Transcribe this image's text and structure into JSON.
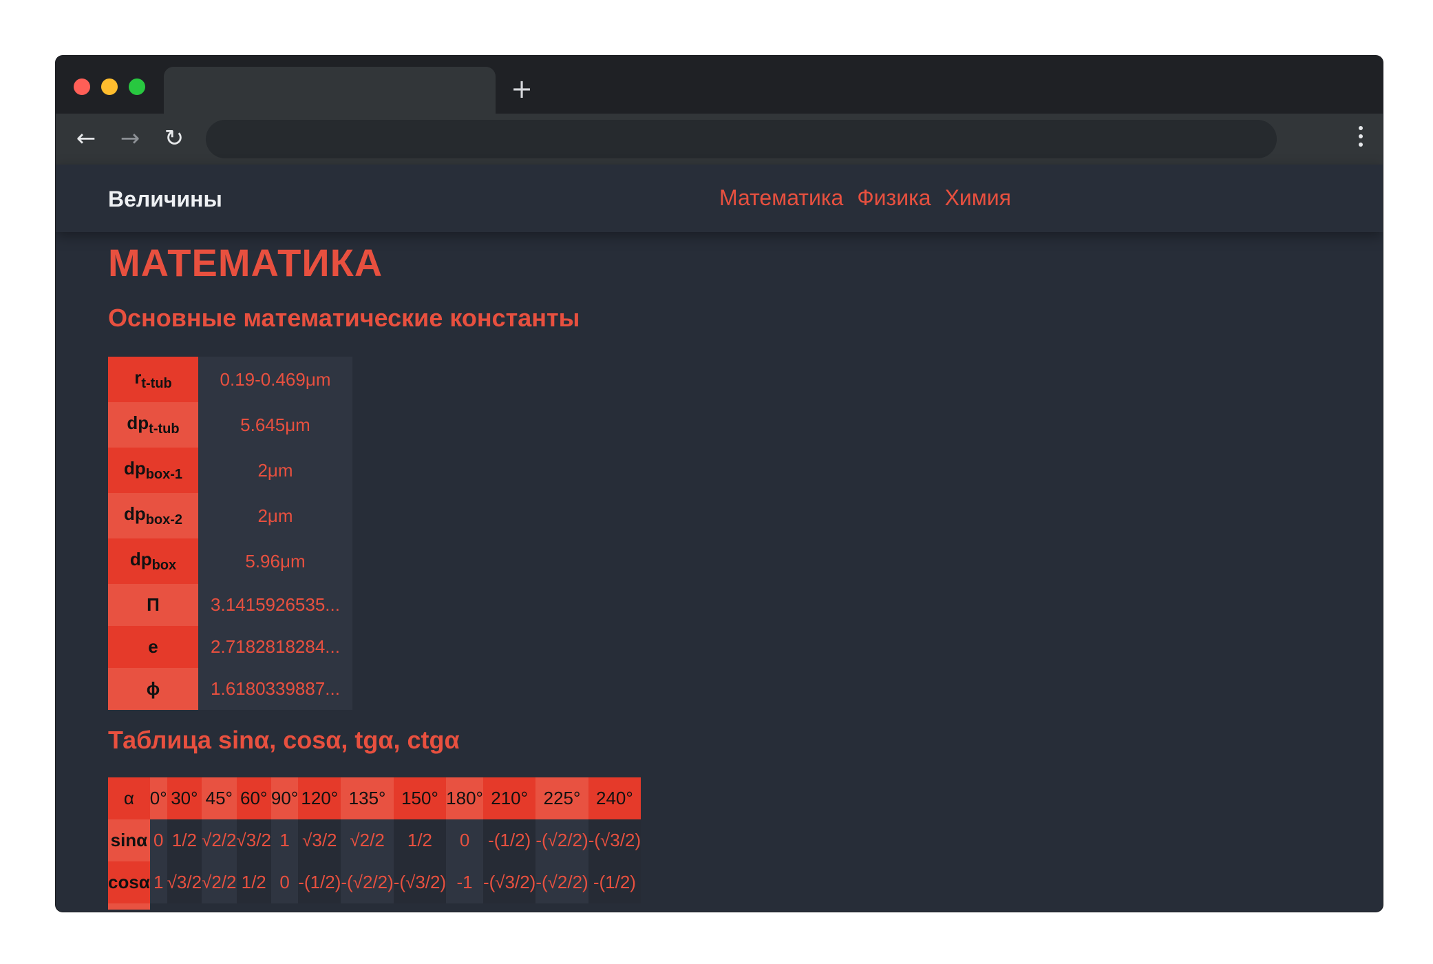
{
  "browser": {
    "new_tab_glyph": "+",
    "back_glyph": "←",
    "forward_glyph": "→",
    "reload_glyph": "↻"
  },
  "header": {
    "brand": "Величины",
    "nav": [
      "Математика",
      "Физика",
      "Химия"
    ]
  },
  "page": {
    "title": "МАТЕМАТИКА",
    "constants_heading": "Основные математические константы",
    "constants": [
      {
        "base": "r",
        "sub": "t-tub",
        "value": "0.19-0.469μm"
      },
      {
        "base": "dp",
        "sub": "t-tub",
        "value": "5.645μm"
      },
      {
        "base": "dp",
        "sub": "box-1",
        "value": "2μm"
      },
      {
        "base": "dp",
        "sub": "box-2",
        "value": "2μm"
      },
      {
        "base": "dp",
        "sub": "box",
        "value": "5.96μm"
      },
      {
        "base": "П",
        "sub": "",
        "value": "3.1415926535..."
      },
      {
        "base": "e",
        "sub": "",
        "value": "2.7182818284..."
      },
      {
        "base": "ϕ",
        "sub": "",
        "value": "1.6180339887..."
      }
    ],
    "trig_heading": "Таблица sinα, cosα, tgα, ctgα",
    "trig_header": [
      "α",
      "0°",
      "30°",
      "45°",
      "60°",
      "90°",
      "120°",
      "135°",
      "150°",
      "180°",
      "210°",
      "225°",
      "240°"
    ],
    "trig_rows": [
      {
        "label": "sinα",
        "values": [
          "0",
          "1/2",
          "√2/2",
          "√3/2",
          "1",
          "√3/2",
          "√2/2",
          "1/2",
          "0",
          "-(1/2)",
          "-(√2/2)",
          "-(√3/2)"
        ]
      },
      {
        "label": "cosα",
        "values": [
          "1",
          "√3/2",
          "√2/2",
          "1/2",
          "0",
          "-(1/2)",
          "-(√2/2)",
          "-(√3/2)",
          "-1",
          "-(√3/2)",
          "-(√2/2)",
          "-(1/2)"
        ]
      }
    ]
  },
  "colors": {
    "accent": "#e8503f",
    "accent_dark": "#e53a2a",
    "page_bg": "#272d38",
    "cell_bg": "#2f3541"
  }
}
